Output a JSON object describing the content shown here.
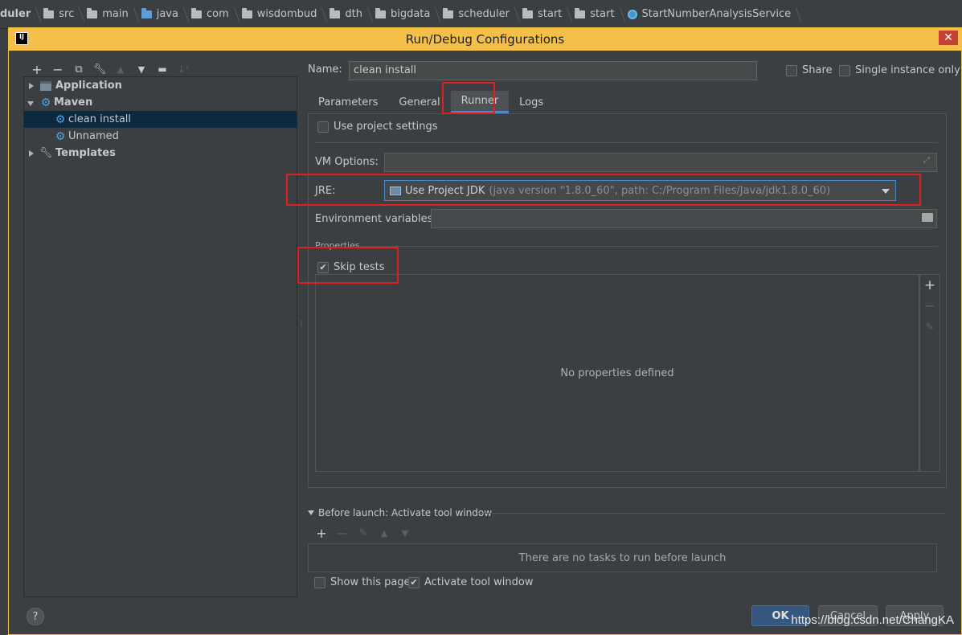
{
  "breadcrumbs": [
    "duler",
    "src",
    "main",
    "java",
    "com",
    "wisdombud",
    "dth",
    "bigdata",
    "scheduler",
    "start",
    "start",
    "StartNumberAnalysisService"
  ],
  "dialog": {
    "title": "Run/Debug Configurations",
    "icon_text": "IJ",
    "close_symbol": "✕"
  },
  "tree_toolbar": {
    "icons": [
      "add-icon",
      "remove-icon",
      "copy-icon",
      "wrench-icon",
      "move-up-icon",
      "move-down-icon",
      "folder-add-icon",
      "sort-icon"
    ]
  },
  "tree": {
    "items": [
      {
        "label": "Application",
        "level": 0,
        "expanded": false,
        "bold": true
      },
      {
        "label": "Maven",
        "level": 0,
        "expanded": true,
        "bold": true
      },
      {
        "label": "clean install",
        "level": 1,
        "selected": true
      },
      {
        "label": "Unnamed",
        "level": 1
      },
      {
        "label": "Templates",
        "level": 0,
        "expanded": false,
        "bold": true
      }
    ]
  },
  "config": {
    "name_label": "Name:",
    "name_value": "clean install",
    "share_label": "Share",
    "share_checked": false,
    "single_instance_label": "Single instance only",
    "single_instance_checked": false
  },
  "tabs": [
    {
      "label": "Parameters",
      "active": false
    },
    {
      "label": "General",
      "active": false
    },
    {
      "label": "Runner",
      "active": true
    },
    {
      "label": "Logs",
      "active": false
    }
  ],
  "runner": {
    "use_project_settings_label": "Use project settings",
    "use_project_settings_checked": false,
    "vm_options_label": "VM Options:",
    "vm_options_value": "",
    "jre_label": "JRE:",
    "jre_value": "Use Project JDK",
    "jre_detail": "(java version \"1.8.0_60\", path: C:/Program Files/Java/jdk1.8.0_60)",
    "env_vars_label": "Environment variables:",
    "env_vars_value": "",
    "properties_label": "Properties",
    "skip_tests_label": "Skip tests",
    "skip_tests_checked": true,
    "no_properties_text": "No properties defined"
  },
  "before_launch": {
    "label": "Before launch: Activate tool window",
    "empty_text": "There are no tasks to run before launch",
    "show_page_label": "Show this page",
    "show_page_checked": false,
    "activate_tool_label": "Activate tool window",
    "activate_tool_checked": true
  },
  "buttons": {
    "help": "?",
    "ok": "OK",
    "cancel": "Cancel",
    "apply": "Apply"
  },
  "watermark": "https://blog.csdn.net/ChangKA",
  "colors": {
    "titlebar": "#f4c04a",
    "highlight": "#e02020",
    "selection": "#0d293e",
    "accent": "#4a88c7"
  }
}
